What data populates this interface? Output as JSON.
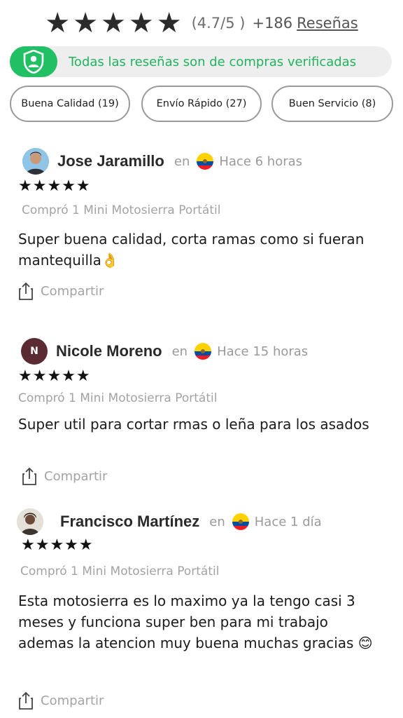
{
  "summary": {
    "stars": "★★★★★",
    "score": "(4.7/5 )",
    "count": "+186",
    "reviews_link": "Reseñas"
  },
  "verified_banner": {
    "text": "Todas las reseñas son de compras verificadas",
    "icon": "shield-user-icon",
    "accent": "#21c064"
  },
  "filters": [
    {
      "label": "Buena Calidad (19)"
    },
    {
      "label": "Envío Rápido (27)"
    },
    {
      "label": "Buen Servicio (8)"
    }
  ],
  "reviews": [
    {
      "name": "Jose Jaramillo",
      "en": "en",
      "country_flag": "ecuador-flag-icon",
      "time": "Hace 6 horas",
      "stars": "★★★★★",
      "product": "Compró 1 Mini Motosierra Portátil",
      "body": "Super buena calidad, corta ramas como si fueran mantequilla👌",
      "share_label": "Compartir"
    },
    {
      "name": "Nicole Moreno",
      "en": "en",
      "country_flag": "ecuador-flag-icon",
      "avatar_initial": "N",
      "time": "Hace 15 horas",
      "stars": "★★★★★",
      "product": "Compró 1 Mini Motosierra Portátil",
      "body": "Super util para cortar rmas o leña para los asados",
      "share_label": "Compartir"
    },
    {
      "name": "Francisco Martínez",
      "en": "en",
      "country_flag": "ecuador-flag-icon",
      "time": "Hace 1 día",
      "stars": "★★★★★",
      "product": "Compró 1 Mini Motosierra Portátil",
      "body": "Esta motosierra es lo maximo ya la tengo casi 3 meses y funciona super ben para mi trabajo ademas la atencion muy buena muchas gracias 😊",
      "share_label": "Compartir"
    }
  ]
}
